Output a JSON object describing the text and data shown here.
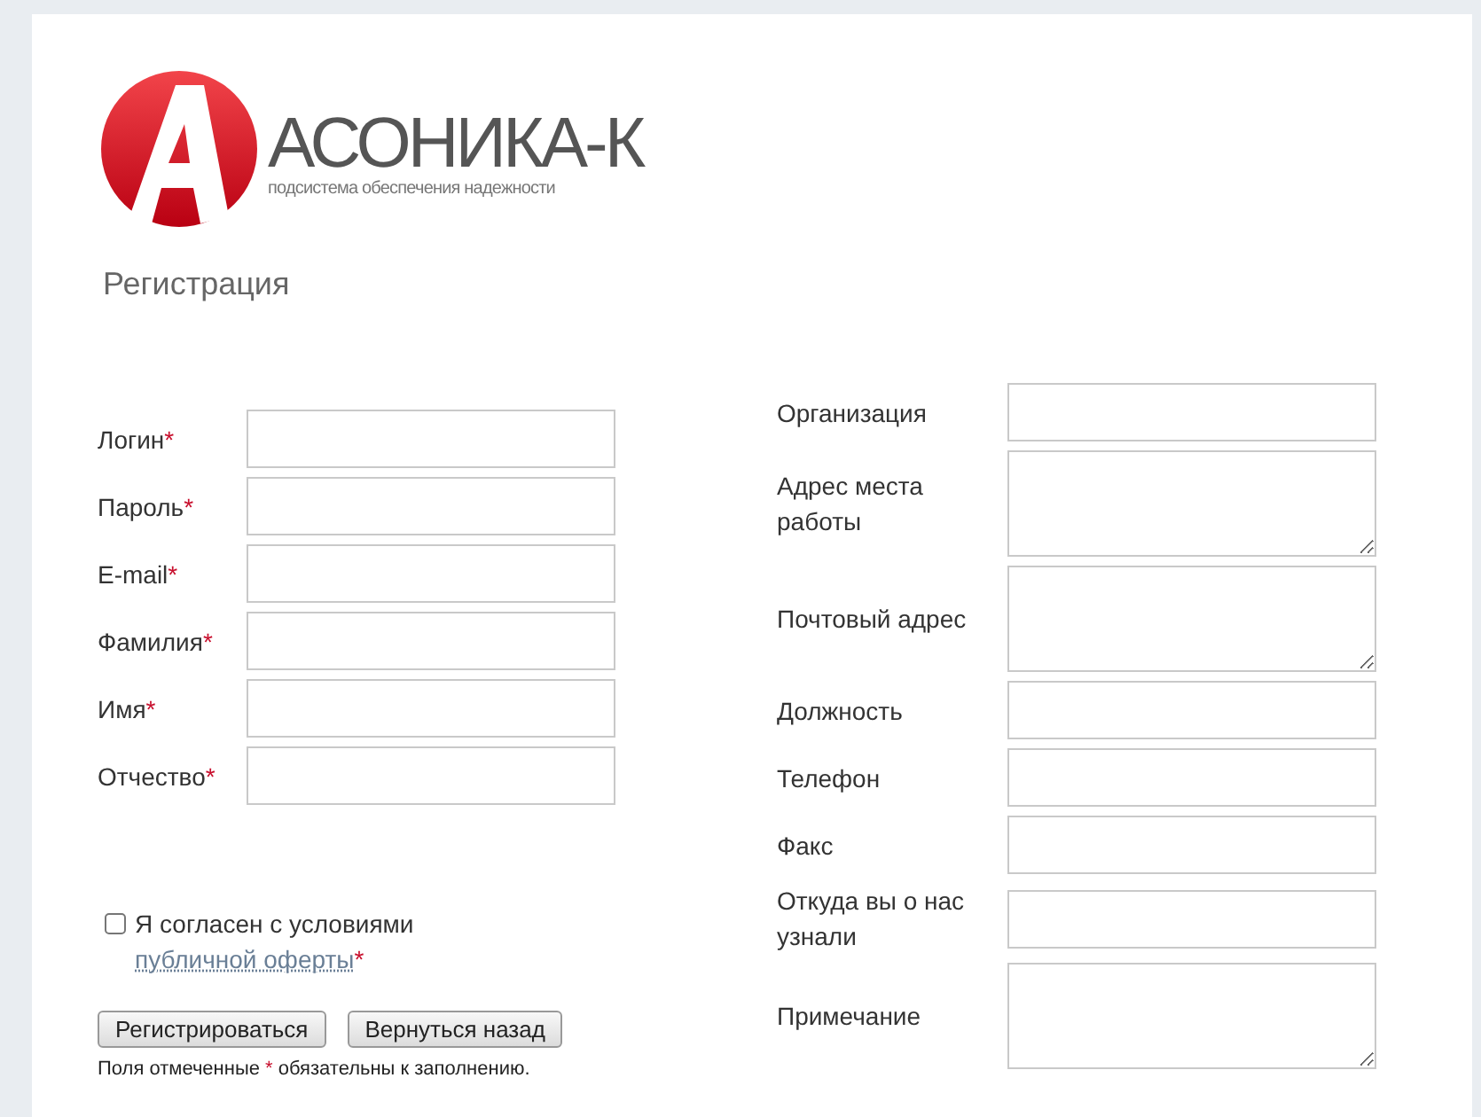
{
  "logo": {
    "name": "АСОНИКА-К",
    "tagline": "подсистема обеспечения надежности"
  },
  "title": "Регистрация",
  "left_fields": [
    {
      "label": "Логин",
      "mark": "*",
      "kind": "input"
    },
    {
      "label": "Пароль",
      "mark": "*",
      "kind": "input"
    },
    {
      "label": "E-mail",
      "mark": "*",
      "kind": "input"
    },
    {
      "label": "Фамилия",
      "mark": "*",
      "kind": "input"
    },
    {
      "label": "Имя",
      "mark": "*",
      "kind": "input"
    },
    {
      "label": "Отчество",
      "mark": "*",
      "kind": "input"
    }
  ],
  "right_fields": [
    {
      "label": "Организация",
      "kind": "input"
    },
    {
      "label": "Адрес места работы",
      "kind": "textarea"
    },
    {
      "label": "Почтовый адрес",
      "kind": "textarea"
    },
    {
      "label": "Должность",
      "kind": "input"
    },
    {
      "label": "Телефон",
      "kind": "input"
    },
    {
      "label": "Факс",
      "kind": "input"
    },
    {
      "label": "Откуда вы о нас узнали",
      "kind": "input"
    },
    {
      "label": "Примечание",
      "kind": "textarea"
    }
  ],
  "agreement": {
    "checked": false,
    "text": "Я согласен с условиями",
    "link": "публичной оферты",
    "mark": "*"
  },
  "buttons": [
    "Регистрироваться",
    "Вернуться назад"
  ],
  "footnote": {
    "before": "Поля отмеченные",
    "mark": "*",
    "after": "обязательны к заполнению."
  }
}
